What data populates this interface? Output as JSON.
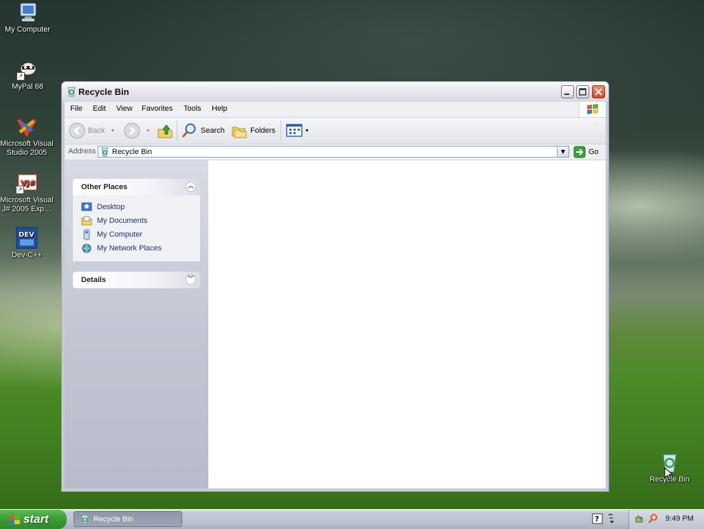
{
  "desktop": {
    "icons": [
      {
        "label": "My Computer"
      },
      {
        "label": "MyPal 68"
      },
      {
        "label": "Microsoft Visual Studio 2005"
      },
      {
        "label": "Microsoft Visual J# 2005 Exp…"
      },
      {
        "label": "Dev-C++"
      },
      {
        "label": "Recycle Bin"
      }
    ],
    "dev_badge": "DEV",
    "vj_badge": "VJ#"
  },
  "window": {
    "title": "Recycle Bin",
    "menu": [
      "File",
      "Edit",
      "View",
      "Favorites",
      "Tools",
      "Help"
    ],
    "toolbar": {
      "back_label": "Back",
      "search_label": "Search",
      "folders_label": "Folders"
    },
    "address": {
      "label": "Address",
      "value": "Recycle Bin",
      "go_label": "Go"
    },
    "taskpane": {
      "other_places_title": "Other Places",
      "places": [
        {
          "label": "Desktop"
        },
        {
          "label": "My Documents"
        },
        {
          "label": "My Computer"
        },
        {
          "label": "My Network Places"
        }
      ],
      "details_title": "Details"
    }
  },
  "taskbar": {
    "start_label": "start",
    "task_label": "Recycle Bin",
    "clock": "9:49 PM"
  },
  "colors": {
    "accent": "#0a56d8",
    "start_green": "#3d9d36",
    "link_blue": "#1c2e6e"
  }
}
